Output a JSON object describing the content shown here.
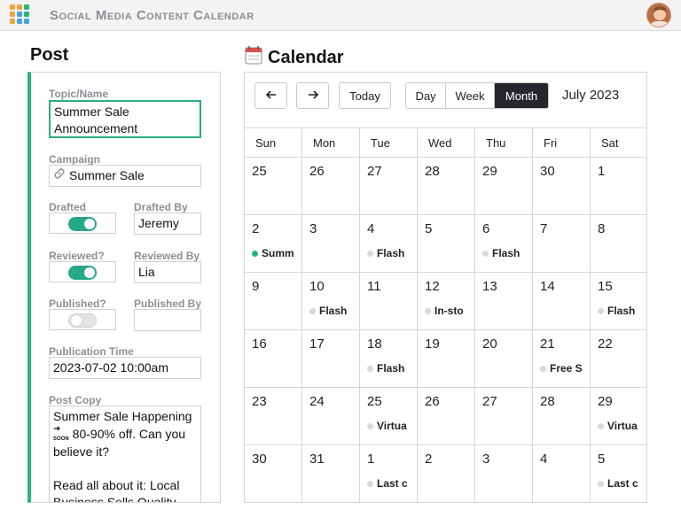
{
  "app": {
    "title": "Social Media Content Calendar"
  },
  "colors": {
    "accent": "#27b57a",
    "active_segment": "#25272c"
  },
  "post": {
    "heading": "Post",
    "topic_label": "Topic/Name",
    "topic_value": "Summer Sale Announcement",
    "campaign_label": "Campaign",
    "campaign_value": "Summer Sale",
    "drafted_label": "Drafted",
    "drafted_on": true,
    "drafted_by_label": "Drafted By",
    "drafted_by_value": "Jeremy",
    "reviewed_label": "Reviewed?",
    "reviewed_on": true,
    "reviewed_by_label": "Reviewed By",
    "reviewed_by_value": "Lia",
    "published_label": "Published?",
    "published_on": false,
    "published_by_label": "Published By",
    "published_by_value": "",
    "pub_time_label": "Publication Time",
    "pub_time_value": "2023-07-02 10:00am",
    "copy_label": "Post Copy",
    "copy_line1": "Summer Sale Happening",
    "copy_line2": "80-90% off. Can you",
    "copy_line3": "believe it?",
    "copy_line4": "Read all about it: Local",
    "copy_line5": "Business Sells Quality"
  },
  "calendar": {
    "heading": "Calendar",
    "today_label": "Today",
    "views": [
      "Day",
      "Week",
      "Month"
    ],
    "active_view": "Month",
    "month_label": "July 2023",
    "weekdays": [
      "Sun",
      "Mon",
      "Tue",
      "Wed",
      "Thu",
      "Fri",
      "Sat"
    ],
    "weeks": [
      [
        {
          "d": "25"
        },
        {
          "d": "26"
        },
        {
          "d": "27"
        },
        {
          "d": "28"
        },
        {
          "d": "29"
        },
        {
          "d": "30"
        },
        {
          "d": "1"
        }
      ],
      [
        {
          "d": "2",
          "e": "Summ",
          "g": true
        },
        {
          "d": "3"
        },
        {
          "d": "4",
          "e": "Flash"
        },
        {
          "d": "5"
        },
        {
          "d": "6",
          "e": "Flash"
        },
        {
          "d": "7"
        },
        {
          "d": "8"
        }
      ],
      [
        {
          "d": "9"
        },
        {
          "d": "10",
          "e": "Flash"
        },
        {
          "d": "11"
        },
        {
          "d": "12",
          "e": "In-sto"
        },
        {
          "d": "13"
        },
        {
          "d": "14"
        },
        {
          "d": "15",
          "e": "Flash"
        }
      ],
      [
        {
          "d": "16"
        },
        {
          "d": "17"
        },
        {
          "d": "18",
          "e": "Flash"
        },
        {
          "d": "19"
        },
        {
          "d": "20"
        },
        {
          "d": "21",
          "e": "Free S"
        },
        {
          "d": "22"
        }
      ],
      [
        {
          "d": "23"
        },
        {
          "d": "24"
        },
        {
          "d": "25",
          "e": "Virtua"
        },
        {
          "d": "26"
        },
        {
          "d": "27"
        },
        {
          "d": "28"
        },
        {
          "d": "29",
          "e": "Virtua"
        }
      ],
      [
        {
          "d": "30"
        },
        {
          "d": "31"
        },
        {
          "d": "1",
          "e": "Last c"
        },
        {
          "d": "2"
        },
        {
          "d": "3"
        },
        {
          "d": "4"
        },
        {
          "d": "5",
          "e": "Last c"
        }
      ]
    ]
  }
}
